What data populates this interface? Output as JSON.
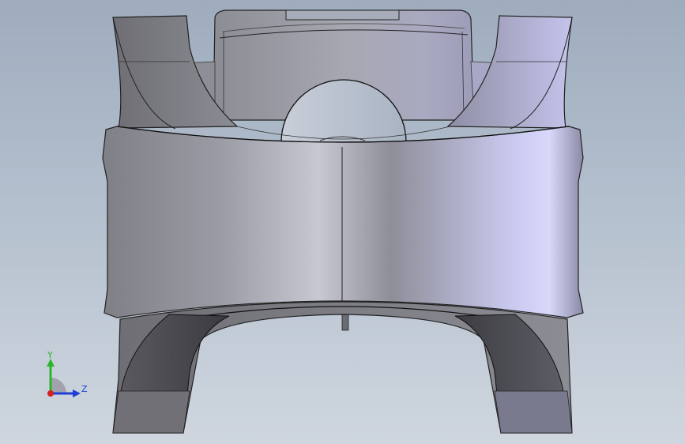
{
  "viewport": {
    "background_top": "#9eacbe",
    "background_bottom": "#cfd6df",
    "model": "piston"
  },
  "triad": {
    "y_label": "Y",
    "z_label": "Z",
    "y_color": "#2bb52b",
    "z_color": "#1f3fd6",
    "origin_color": "#d42020"
  }
}
